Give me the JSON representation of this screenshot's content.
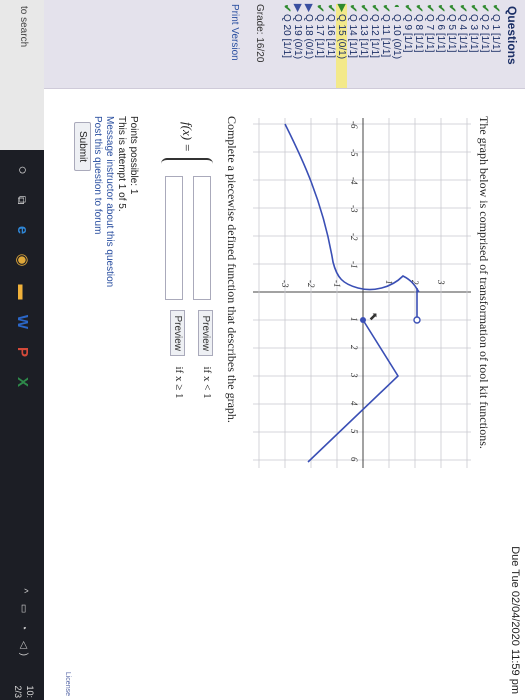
{
  "nav": {
    "header": "Questions",
    "items": [
      {
        "label": "Q 1 [1/1]",
        "mark": "✔",
        "state": "done"
      },
      {
        "label": "Q 2 [1/1]",
        "mark": "✔",
        "state": "done"
      },
      {
        "label": "Q 3 [1/1]",
        "mark": "✔",
        "state": "done"
      },
      {
        "label": "Q 4 [1/1]",
        "mark": "✔",
        "state": "done"
      },
      {
        "label": "Q 5 [1/1]",
        "mark": "✔",
        "state": "done"
      },
      {
        "label": "Q 6 [1/1]",
        "mark": "✔",
        "state": "done"
      },
      {
        "label": "Q 7 [1/1]",
        "mark": "✔",
        "state": "done"
      },
      {
        "label": "Q 8 [1/1]",
        "mark": "✔",
        "state": "done"
      },
      {
        "label": "Q 9 [1/1]",
        "mark": "✔",
        "state": "done"
      },
      {
        "label": "Q 10 (0/1)",
        "mark": "◐",
        "state": "partial"
      },
      {
        "label": "Q 11 [1/1]",
        "mark": "✔",
        "state": "done"
      },
      {
        "label": "Q 12 [1/1]",
        "mark": "✔",
        "state": "done"
      },
      {
        "label": "Q 13 [1/1]",
        "mark": "✔",
        "state": "done"
      },
      {
        "label": "Q 14 [1/1]",
        "mark": "✔",
        "state": "done"
      },
      {
        "label": "Q 15 (0/1)",
        "mark": "▶",
        "state": "current"
      },
      {
        "label": "Q 16 [1/1]",
        "mark": "✔",
        "state": "done"
      },
      {
        "label": "Q 17 [1/1]",
        "mark": "✔",
        "state": "done"
      },
      {
        "label": "Q 18 (0/1)",
        "mark": "▶",
        "state": "wrong"
      },
      {
        "label": "Q 19 (0/1)",
        "mark": "▶",
        "state": "wrong"
      },
      {
        "label": "Q 20 [1/1]",
        "mark": "✔",
        "state": "done"
      }
    ],
    "grade": "Grade: 16/20",
    "print_version": "Print Version"
  },
  "due": "Due Tue 02/04/2020 11:59 pm",
  "prompt": "The graph below is comprised of transformation of tool kit functions.",
  "graph": {
    "x_ticks": [
      "-6",
      "-5",
      "-4",
      "-3",
      "-2",
      "-1",
      "1",
      "2",
      "3",
      "4",
      "5",
      "6"
    ],
    "y_ticks": [
      "-3",
      "-2",
      "-1",
      "1",
      "2",
      "3",
      "5"
    ]
  },
  "instruction": "Complete a piecewise defined function that describes the graph.",
  "piecewise": {
    "fx_label": "f(x) =",
    "rows": [
      {
        "value": "",
        "preview": "Preview",
        "condition": "if x < 1"
      },
      {
        "value": "",
        "preview": "Preview",
        "condition": "if x ≥ 1"
      }
    ]
  },
  "info": {
    "points": "Points possible: 1",
    "attempt": "This is attempt 1 of 5.",
    "message": "Message instructor about this question",
    "forum": "Post this question to forum"
  },
  "submit_label": "Submit",
  "license": "License",
  "taskbar": {
    "search": "to search",
    "clock_time": "10:",
    "clock_date": "2/3"
  }
}
